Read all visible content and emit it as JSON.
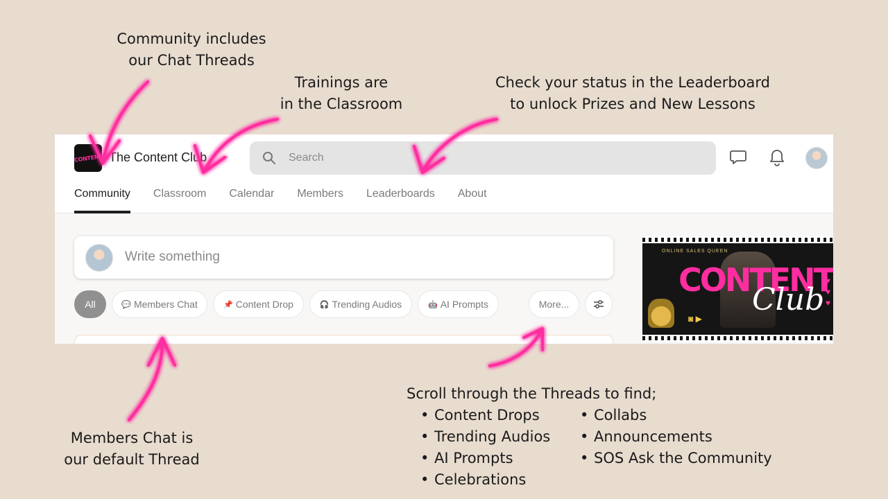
{
  "annotations": {
    "community": {
      "line1": "Community includes",
      "line2": "our Chat Threads"
    },
    "trainings": {
      "line1": "Trainings are",
      "line2": "in the Classroom"
    },
    "leaderboard": {
      "line1": "Check your status in the Leaderboard",
      "line2": "to unlock Prizes and New Lessons"
    },
    "members_chat": {
      "line1": "Members Chat is",
      "line2": "our default Thread"
    },
    "scroll": {
      "intro": "Scroll through the Threads to find;",
      "col1": [
        "Content Drops",
        "Trending Audios",
        "AI Prompts",
        "Celebrations"
      ],
      "col2": [
        "Collabs",
        "Announcements",
        "SOS Ask the Community"
      ]
    }
  },
  "header": {
    "logo_text": "CONTENT",
    "group_name": "The Content Club",
    "search_placeholder": "Search"
  },
  "tabs": [
    "Community",
    "Classroom",
    "Calendar",
    "Members",
    "Leaderboards",
    "About"
  ],
  "active_tab": "Community",
  "composer": {
    "placeholder": "Write something"
  },
  "filters": {
    "all": "All",
    "members_chat": "Members Chat",
    "content_drop": "Content Drop",
    "trending_audios": "Trending Audios",
    "ai_prompts": "AI Prompts",
    "more": "More..."
  },
  "filter_icons": {
    "members_chat": "💬",
    "content_drop": "📌",
    "trending_audios": "🎧",
    "ai_prompts": "🤖"
  },
  "banner": {
    "sub": "ONLINE SALES QUEEN",
    "title": "CONTENT",
    "script": "Club"
  },
  "colors": {
    "background": "#e8dccf",
    "arrow": "#ff2da0",
    "active_chip": "#909090"
  }
}
